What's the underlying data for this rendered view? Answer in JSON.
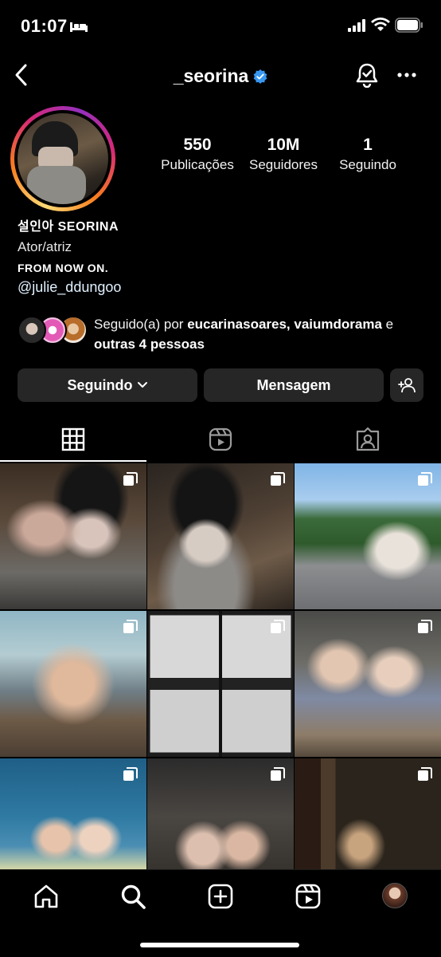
{
  "status_bar": {
    "time": "01:07"
  },
  "header": {
    "username": "_seorina"
  },
  "stats": [
    {
      "value": "550",
      "label": "Publicações"
    },
    {
      "value": "10M",
      "label": "Seguidores"
    },
    {
      "value": "1",
      "label": "Seguindo"
    }
  ],
  "bio": {
    "name": "설인아 SEORINA",
    "category": "Ator/atriz",
    "line": "FROM NOW ON.",
    "link": "@julie_ddungoo"
  },
  "followed_by": {
    "prefix": "Seguido(a) por ",
    "accounts": "eucarinasoares, vaiumdorama",
    "middle": "e ",
    "others": "outras 4 pessoas"
  },
  "actions": {
    "following_label": "Seguindo",
    "message_label": "Mensagem"
  },
  "tabs": [
    "grid-icon",
    "reels-icon",
    "tagged-icon"
  ],
  "colors": {
    "background": "#000000",
    "button_bg": "#262626",
    "verified_blue": "#3897f0",
    "link_text": "#e0f1ff"
  },
  "bottom_nav": [
    "home-icon",
    "search-icon",
    "create-icon",
    "reels-icon",
    "profile-avatar"
  ]
}
